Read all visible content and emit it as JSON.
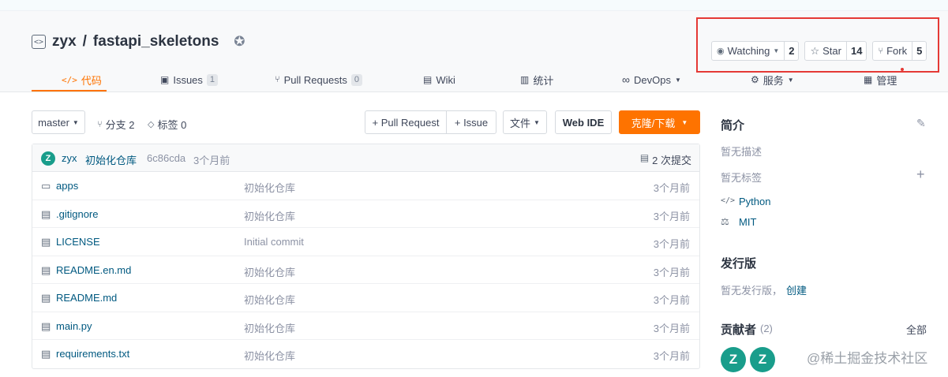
{
  "repo": {
    "owner": "zyx",
    "separator": "/",
    "name": "fastapi_skeletons"
  },
  "actions": {
    "watch_label": "Watching",
    "watch_count": "2",
    "star_label": "Star",
    "star_count": "14",
    "fork_label": "Fork",
    "fork_count": "5"
  },
  "tabs": [
    {
      "label": "代码",
      "icon": "code-icon",
      "active": true
    },
    {
      "label": "Issues",
      "badge": "1",
      "icon": "issues-icon"
    },
    {
      "label": "Pull Requests",
      "badge": "0",
      "icon": "pull-request-icon"
    },
    {
      "label": "Wiki",
      "icon": "wiki-icon"
    },
    {
      "label": "统计",
      "icon": "stats-icon"
    },
    {
      "label": "DevOps",
      "icon": "devops-icon"
    },
    {
      "label": "服务",
      "icon": "service-icon"
    },
    {
      "label": "管理",
      "icon": "manage-icon"
    }
  ],
  "toolbar": {
    "branch": "master",
    "branches": "分支 2",
    "tags": "标签 0",
    "pull_request": "+ Pull Request",
    "issue": "+ Issue",
    "files": "文件",
    "web_ide": "Web IDE",
    "clone": "克隆/下载"
  },
  "commit": {
    "avatar_letter": "Z",
    "author": "zyx",
    "message": "初始化仓库",
    "hash": "6c86cda",
    "time": "3个月前",
    "commits": "2 次提交"
  },
  "files": [
    {
      "name": "apps",
      "type": "folder",
      "message": "初始化仓库",
      "time": "3个月前"
    },
    {
      "name": ".gitignore",
      "type": "file",
      "message": "初始化仓库",
      "time": "3个月前"
    },
    {
      "name": "LICENSE",
      "type": "file",
      "message": "Initial commit",
      "time": "3个月前"
    },
    {
      "name": "README.en.md",
      "type": "file",
      "message": "初始化仓库",
      "time": "3个月前"
    },
    {
      "name": "README.md",
      "type": "file",
      "message": "初始化仓库",
      "time": "3个月前"
    },
    {
      "name": "main.py",
      "type": "file",
      "message": "初始化仓库",
      "time": "3个月前"
    },
    {
      "name": "requirements.txt",
      "type": "file",
      "message": "初始化仓库",
      "time": "3个月前"
    }
  ],
  "sidebar": {
    "intro_title": "简介",
    "no_desc": "暂无描述",
    "no_tags": "暂无标签",
    "language": "Python",
    "license": "MIT",
    "release_title": "发行版",
    "no_release": "暂无发行版，",
    "create": "创建",
    "contrib_title": "贡献者",
    "contrib_count": "(2)",
    "all": "全部",
    "contributors": [
      "Z",
      "Z"
    ]
  },
  "watermark": "@稀土掘金技术社区",
  "colors": {
    "accent": "#fe7300",
    "link": "#005980",
    "avatar": "#199d8b",
    "highlight": "#e53935"
  }
}
